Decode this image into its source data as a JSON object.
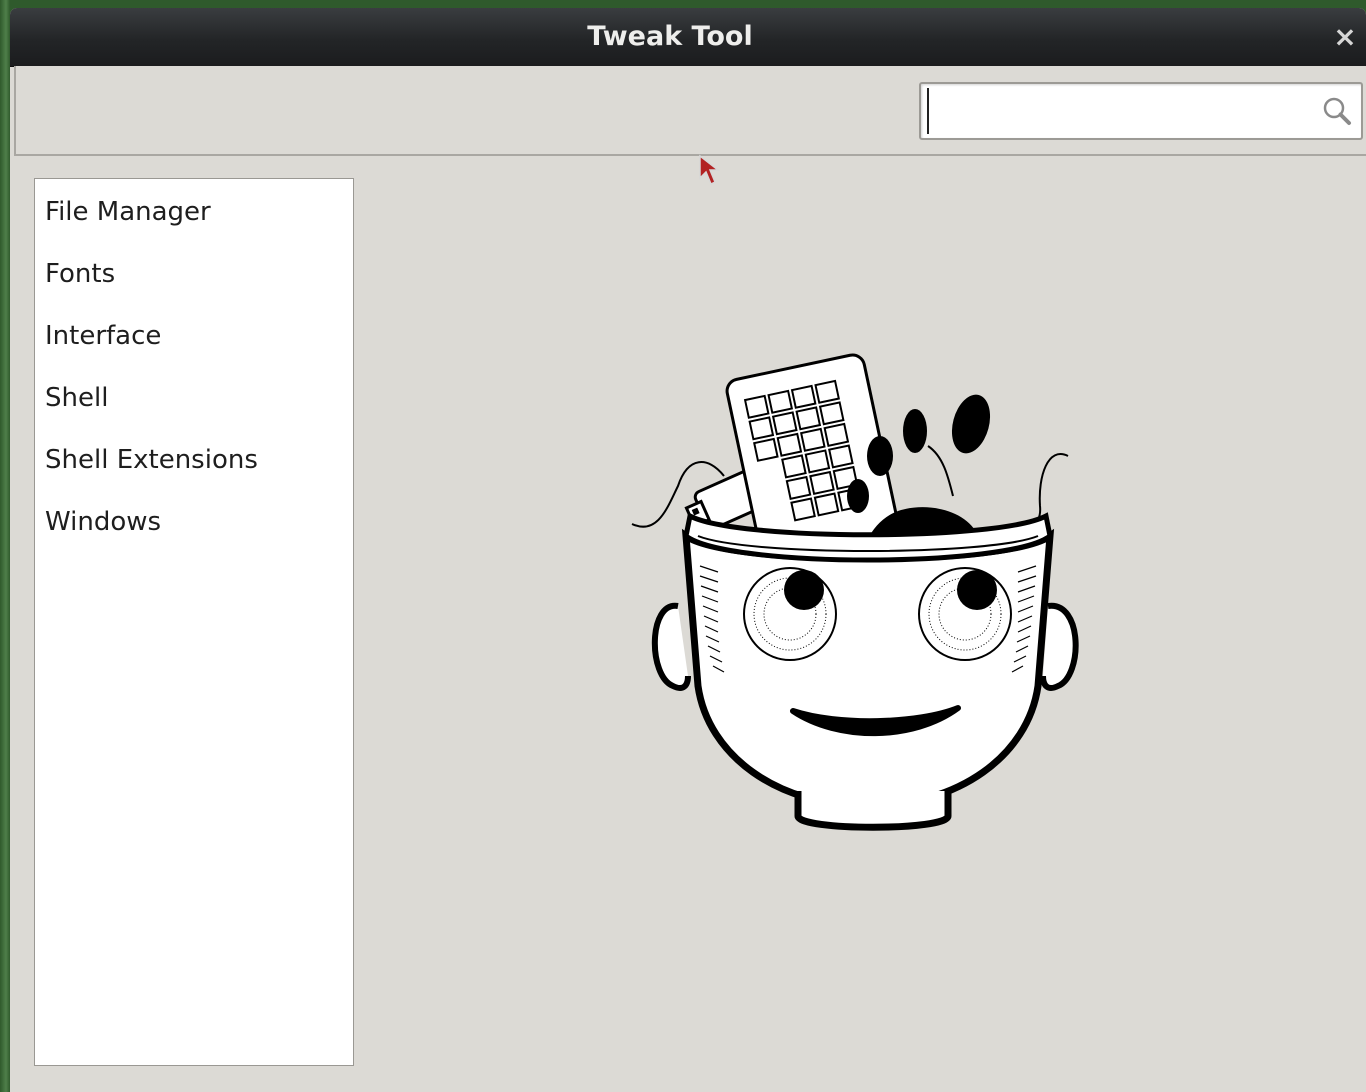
{
  "window": {
    "title": "Tweak Tool",
    "close_glyph": "×"
  },
  "search": {
    "value": "",
    "placeholder": "",
    "icon": "search-icon"
  },
  "sidebar": {
    "items": [
      {
        "label": "File Manager"
      },
      {
        "label": "Fonts"
      },
      {
        "label": "Interface"
      },
      {
        "label": "Shell"
      },
      {
        "label": "Shell Extensions"
      },
      {
        "label": "Windows"
      }
    ]
  },
  "main": {
    "illustration": "tweak-tool-mascot"
  },
  "colors": {
    "titlebar": "#232527",
    "window_bg": "#dcdad5",
    "sidebar_bg": "#ffffff",
    "desktop": "#3f6a3c",
    "cursor": "#b22222"
  }
}
